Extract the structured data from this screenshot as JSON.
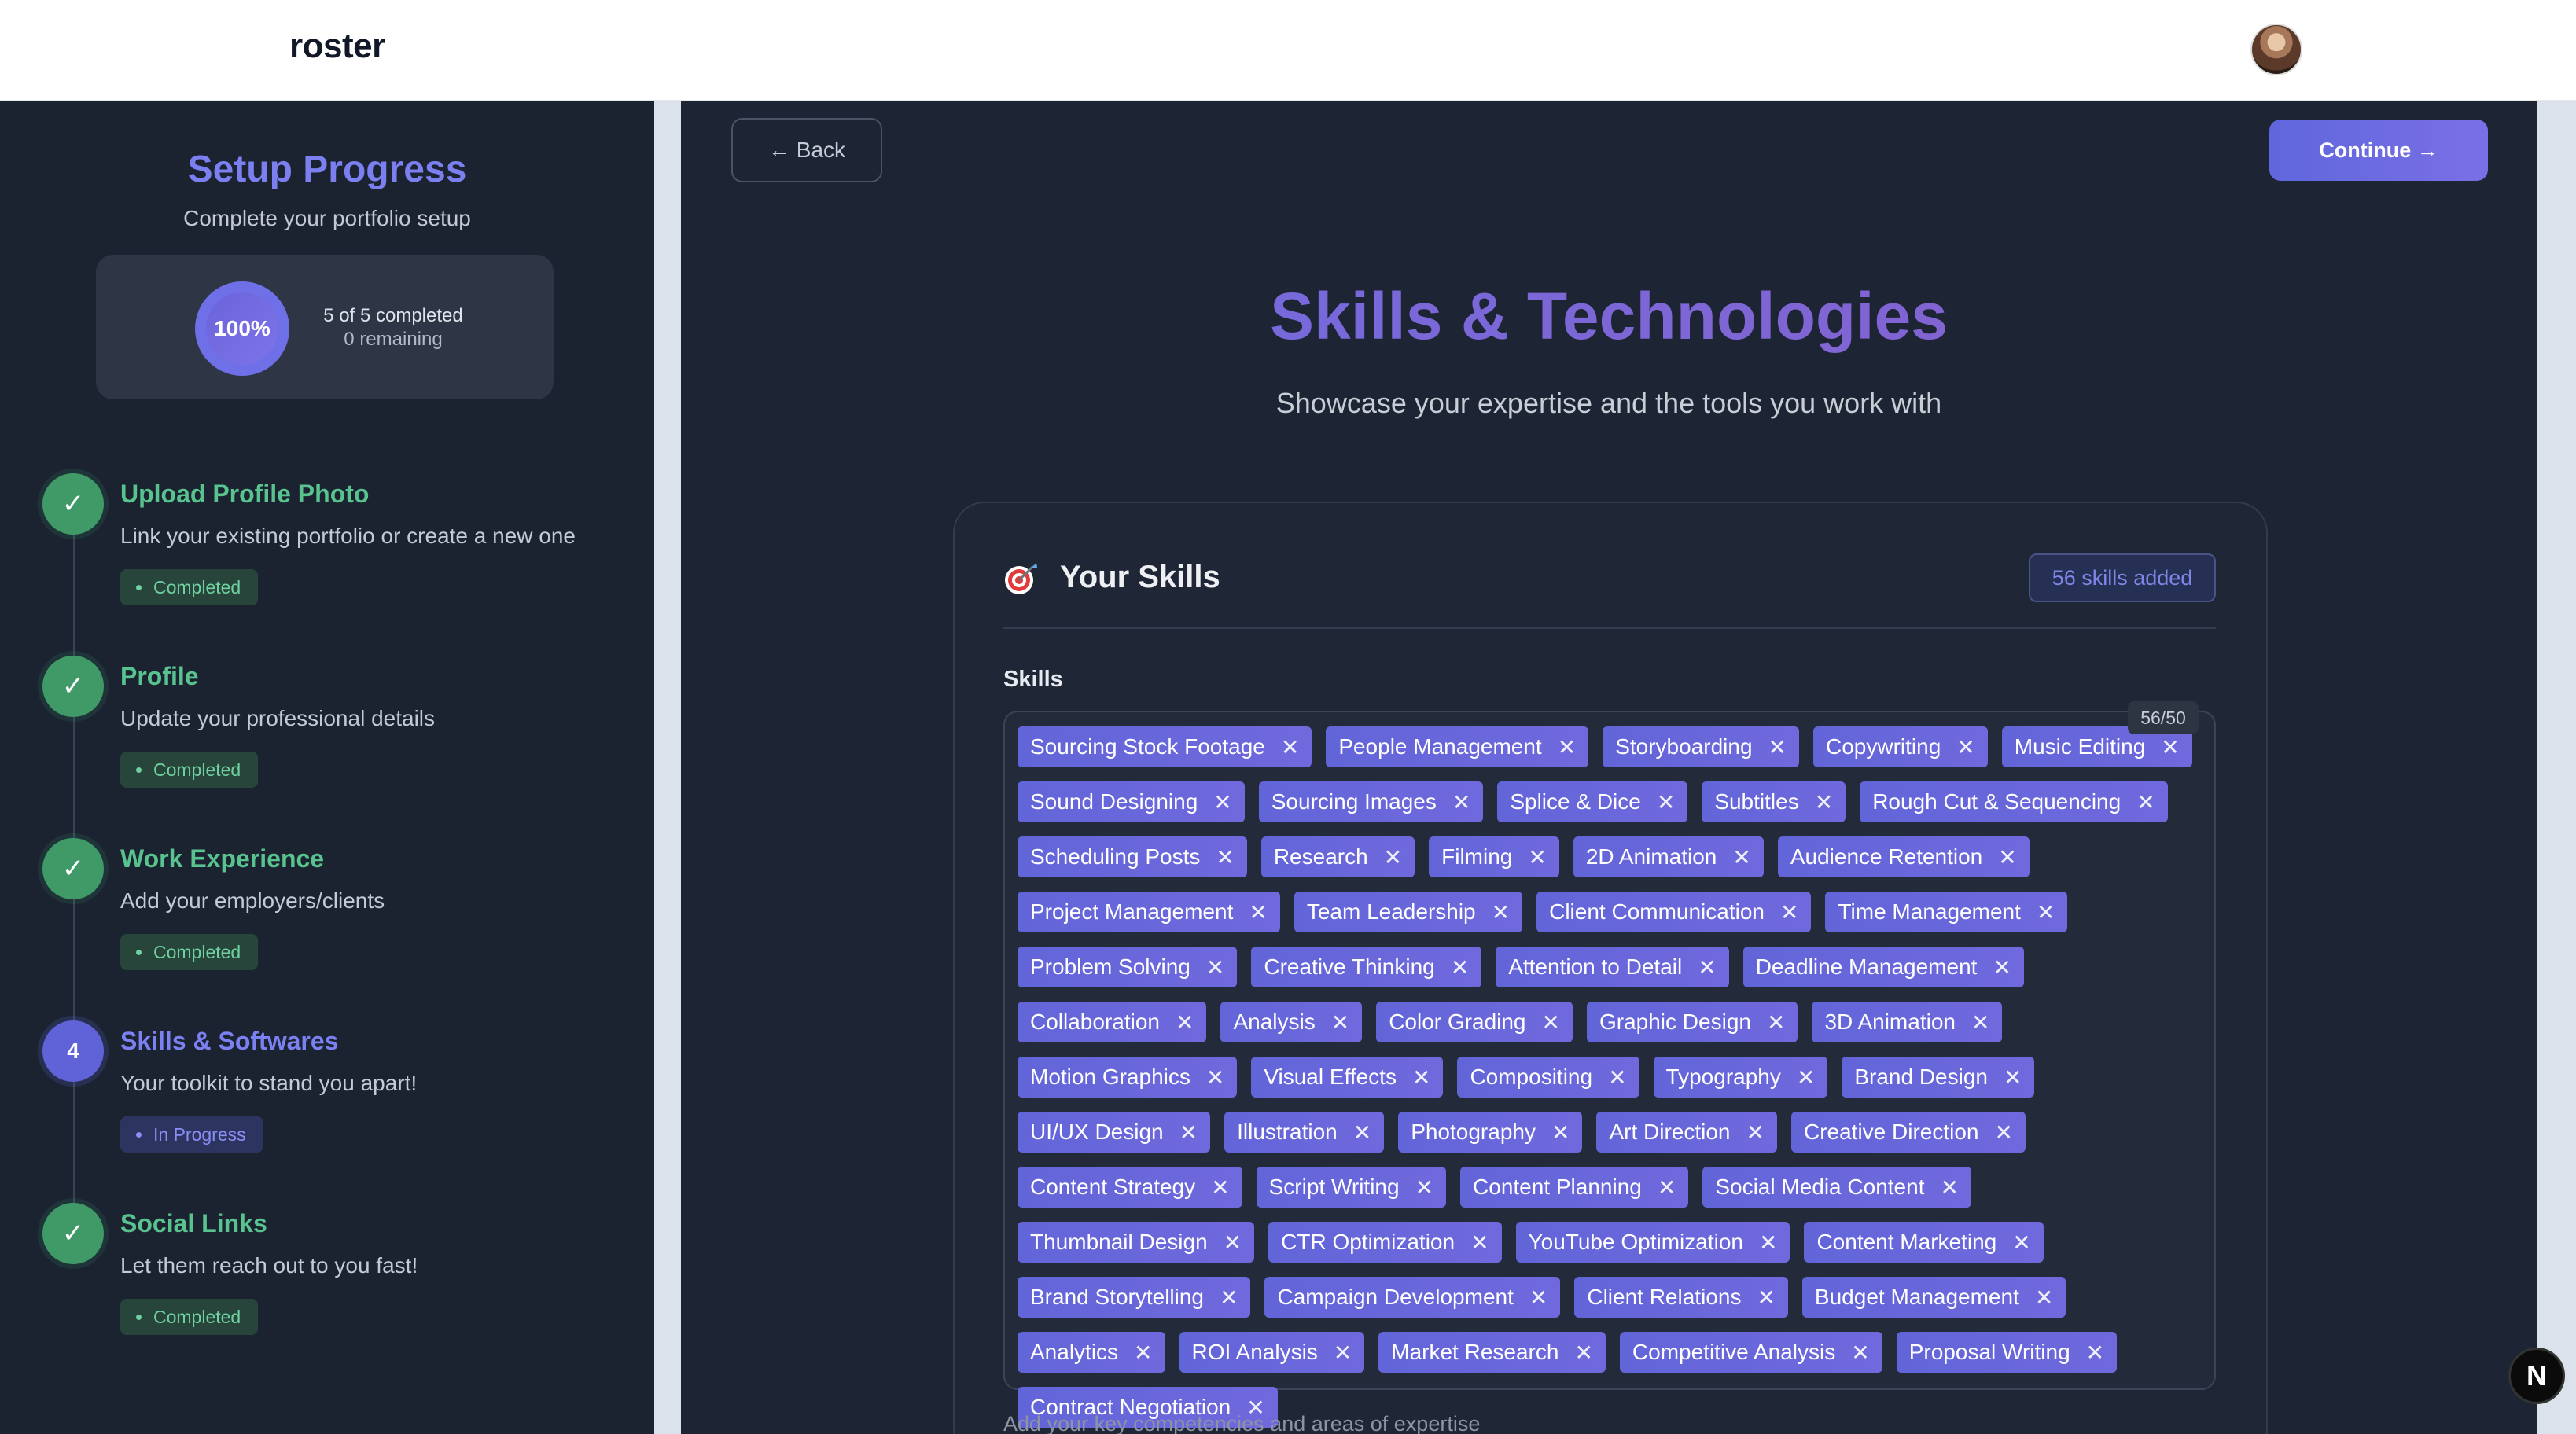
{
  "header": {
    "logo": "roster"
  },
  "sidebar": {
    "title": "Setup Progress",
    "subtitle": "Complete your portfolio setup",
    "progress": {
      "percent_label": "100%",
      "percent": 100,
      "completed_text": "5 of 5 completed",
      "remaining_text": "0 remaining"
    },
    "steps": [
      {
        "title": "Upload Profile Photo",
        "desc": "Link your existing portfolio or create a new one",
        "status": "Completed",
        "marker": "✓"
      },
      {
        "title": "Profile",
        "desc": "Update your professional details",
        "status": "Completed",
        "marker": "✓"
      },
      {
        "title": "Work Experience",
        "desc": "Add your employers/clients",
        "status": "Completed",
        "marker": "✓"
      },
      {
        "title": "Skills & Softwares",
        "desc": "Your toolkit to stand you apart!",
        "status": "In Progress",
        "marker": "4"
      },
      {
        "title": "Social Links",
        "desc": "Let them reach out to you fast!",
        "status": "Completed",
        "marker": "✓"
      }
    ]
  },
  "nav": {
    "back_label": "← Back",
    "continue_label": "Continue →"
  },
  "main": {
    "title": "Skills & Technologies",
    "subtitle": "Showcase your expertise and the tools you work with"
  },
  "skills_card": {
    "icon": "target-icon",
    "title": "Your Skills",
    "count_badge": "56 skills added",
    "field_label": "Skills",
    "counter": "56/50",
    "remove_glyph": "✕",
    "hint": "Add your key competencies and areas of expertise",
    "tags": [
      "Sourcing Stock Footage",
      "People Management",
      "Storyboarding",
      "Copywriting",
      "Music Editing",
      "Sound Designing",
      "Sourcing Images",
      "Splice & Dice",
      "Subtitles",
      "Rough Cut & Sequencing",
      "Scheduling Posts",
      "Research",
      "Filming",
      "2D Animation",
      "Audience Retention",
      "Project Management",
      "Team Leadership",
      "Client Communication",
      "Time Management",
      "Problem Solving",
      "Creative Thinking",
      "Attention to Detail",
      "Deadline Management",
      "Collaboration",
      "Analysis",
      "Color Grading",
      "Graphic Design",
      "3D Animation",
      "Motion Graphics",
      "Visual Effects",
      "Compositing",
      "Typography",
      "Brand Design",
      "UI/UX Design",
      "Illustration",
      "Photography",
      "Art Direction",
      "Creative Direction",
      "Content Strategy",
      "Script Writing",
      "Content Planning",
      "Social Media Content",
      "Thumbnail Design",
      "CTR Optimization",
      "YouTube Optimization",
      "Content Marketing",
      "Brand Storytelling",
      "Campaign Development",
      "Client Relations",
      "Budget Management",
      "Analytics",
      "ROI Analysis",
      "Market Research",
      "Competitive Analysis",
      "Proposal Writing",
      "Contract Negotiation"
    ]
  },
  "floating_badge": {
    "label": "N"
  },
  "colors": {
    "accent": "#6366f1",
    "success": "#3f9a68",
    "sidebar_bg": "#1b2331",
    "main_bg": "#1d2433"
  }
}
